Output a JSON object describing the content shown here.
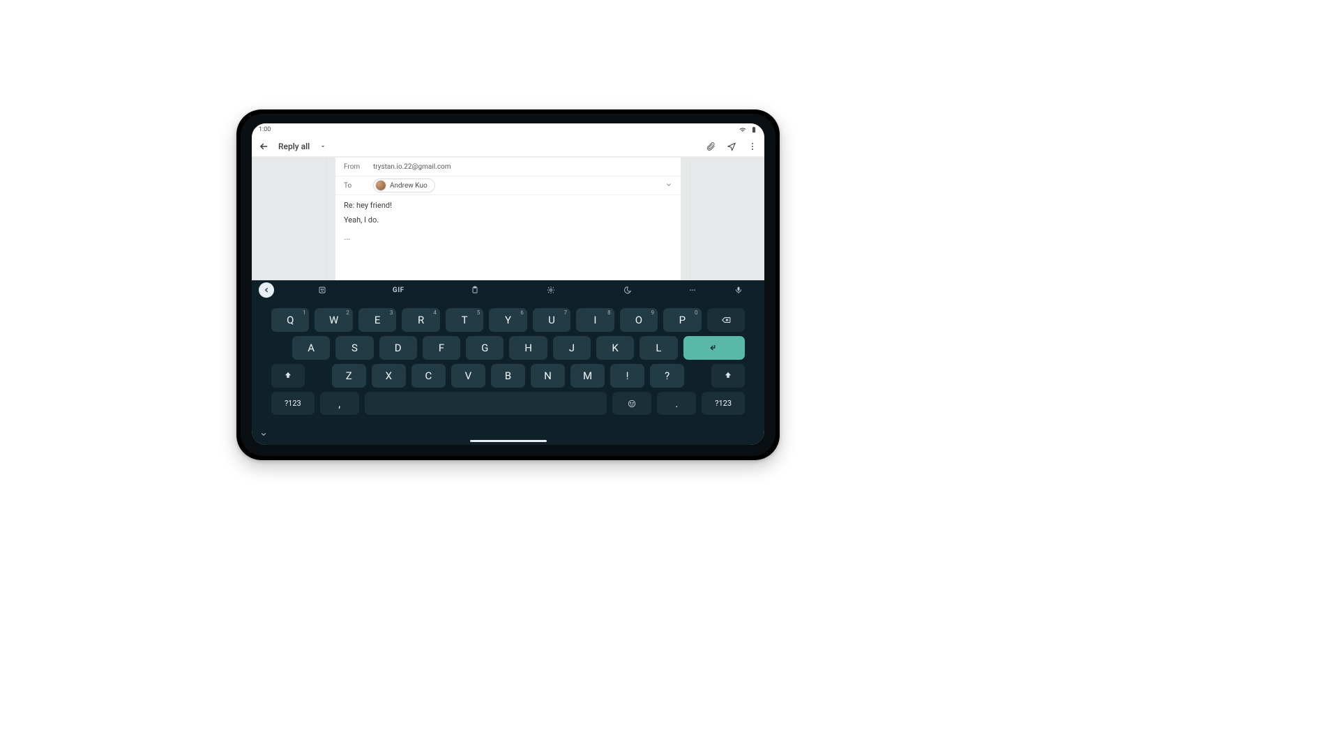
{
  "status": {
    "time": "1:00"
  },
  "appbar": {
    "title": "Reply all"
  },
  "compose": {
    "from_label": "From",
    "from_value": "trystan.io.22@gmail.com",
    "to_label": "To",
    "recipient_name": "Andrew Kuo",
    "subject": "Re: hey friend!",
    "body": "Yeah, I do.",
    "quoted_indicator": "…"
  },
  "keyboard": {
    "gif_label": "GIF",
    "row1": [
      {
        "k": "Q",
        "h": "1"
      },
      {
        "k": "W",
        "h": "2"
      },
      {
        "k": "E",
        "h": "3"
      },
      {
        "k": "R",
        "h": "4"
      },
      {
        "k": "T",
        "h": "5"
      },
      {
        "k": "Y",
        "h": "6"
      },
      {
        "k": "U",
        "h": "7"
      },
      {
        "k": "I",
        "h": "8"
      },
      {
        "k": "O",
        "h": "9"
      },
      {
        "k": "P",
        "h": "0"
      }
    ],
    "row2": [
      {
        "k": "A"
      },
      {
        "k": "S"
      },
      {
        "k": "D"
      },
      {
        "k": "F"
      },
      {
        "k": "G"
      },
      {
        "k": "H"
      },
      {
        "k": "J"
      },
      {
        "k": "K"
      },
      {
        "k": "L"
      }
    ],
    "row3": [
      {
        "k": "Z"
      },
      {
        "k": "X"
      },
      {
        "k": "C"
      },
      {
        "k": "V"
      },
      {
        "k": "B"
      },
      {
        "k": "N"
      },
      {
        "k": "M"
      },
      {
        "k": "!"
      },
      {
        "k": "?"
      }
    ],
    "symbols_label": "?123",
    "comma": ",",
    "period": "."
  }
}
